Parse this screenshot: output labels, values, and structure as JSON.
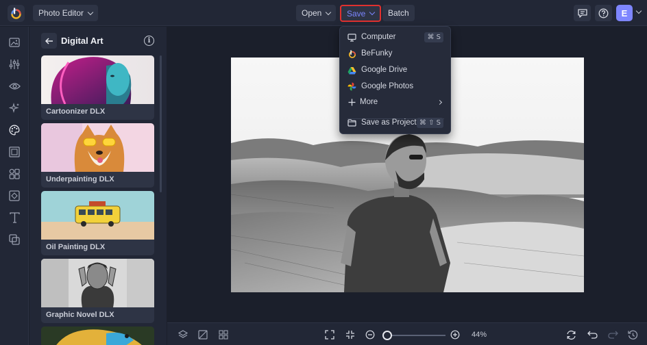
{
  "app": {
    "menu_label": "Photo Editor",
    "open_label": "Open",
    "save_label": "Save",
    "batch_label": "Batch",
    "user_initial": "E"
  },
  "left_toolbar": {
    "tools": [
      "image-icon",
      "adjust-sliders-icon",
      "eye-icon",
      "sparkle-icon",
      "palette-icon",
      "frame-icon",
      "elements-icon",
      "texture-icon",
      "text-icon",
      "layers-icon"
    ]
  },
  "panel": {
    "title": "Digital Art",
    "cards": [
      {
        "label": "Cartoonizer DLX"
      },
      {
        "label": "Underpainting DLX"
      },
      {
        "label": "Oil Painting DLX"
      },
      {
        "label": "Graphic Novel DLX"
      }
    ]
  },
  "save_menu": {
    "items": [
      {
        "label": "Computer",
        "shortcut": "⌘ S",
        "icon": "monitor-icon"
      },
      {
        "label": "BeFunky",
        "icon": "befunky-icon"
      },
      {
        "label": "Google Drive",
        "icon": "google-drive-icon"
      },
      {
        "label": "Google Photos",
        "icon": "google-photos-icon"
      },
      {
        "label": "More",
        "icon": "plus-icon"
      },
      {
        "label": "Save as Project",
        "shortcut": "⌘ ⇧ S",
        "icon": "folder-icon"
      }
    ]
  },
  "bottom_bar": {
    "zoom_label": "44%",
    "zoom_fraction": 0.44
  },
  "colors": {
    "accent": "#7e86ff",
    "highlight_border": "#e1312f",
    "background": "#1b1f2b",
    "panel": "#222736"
  }
}
